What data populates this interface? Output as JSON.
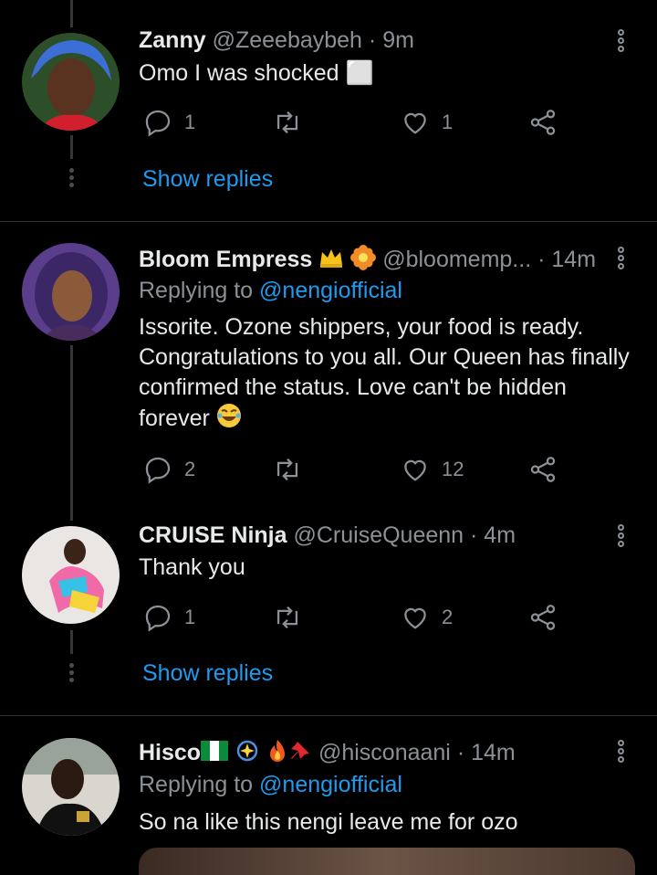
{
  "tweets": [
    {
      "name": "Zanny",
      "handle": "@Zeeebaybeh",
      "time": "· 9m",
      "text": "Omo I was shocked ⬜",
      "replies": "1",
      "retweets": "",
      "likes": "1",
      "show_replies": "Show replies"
    },
    {
      "name": "Bloom Empress",
      "handle": "@bloomemp...",
      "time": "· 14m",
      "replying_label": "Replying to",
      "replying_to": "@nengiofficial",
      "text": "Issorite. Ozone shippers, your food is ready. Congratulations to you all. Our Queen has finally confirmed the status. Love can't be hidden forever",
      "replies": "2",
      "retweets": "",
      "likes": "12"
    },
    {
      "name": "CRUISE Ninja",
      "handle": "@CruiseQueenn",
      "time": "· 4m",
      "text": "Thank you",
      "replies": "1",
      "retweets": "",
      "likes": "2",
      "show_replies": "Show replies"
    },
    {
      "name": "Hisco",
      "handle": "@hisconaani",
      "time": "· 14m",
      "replying_label": "Replying to",
      "replying_to": "@nengiofficial",
      "text": "So na like this nengi leave me for ozo"
    }
  ],
  "colors": {
    "background": "#000000",
    "text": "#e7e9ea",
    "secondary": "#8b9196",
    "accent": "#1d9bf0"
  },
  "icons": [
    "reply-icon",
    "retweet-icon",
    "like-icon",
    "share-icon",
    "more-icon",
    "crown-emoji",
    "flower-emoji",
    "laughing-emoji",
    "flag-emoji",
    "sparkle-emoji",
    "fire-emoji",
    "pin-emoji"
  ]
}
